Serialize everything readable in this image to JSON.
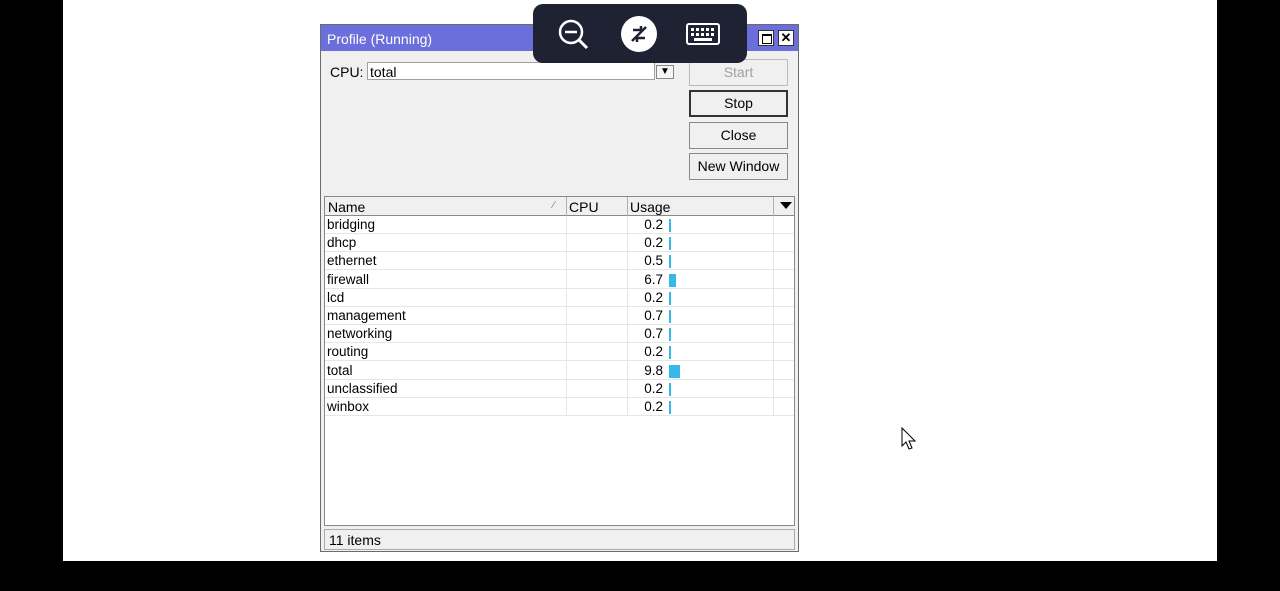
{
  "window": {
    "title": "Profile (Running)"
  },
  "cpu": {
    "label": "CPU:",
    "value": "total"
  },
  "buttons": {
    "start": "Start",
    "stop": "Stop",
    "close": "Close",
    "new_window": "New Window"
  },
  "table": {
    "columns": [
      "Name",
      "CPU",
      "Usage"
    ],
    "rows": [
      {
        "name": "bridging",
        "usage": "0.2"
      },
      {
        "name": "dhcp",
        "usage": "0.2"
      },
      {
        "name": "ethernet",
        "usage": "0.5"
      },
      {
        "name": "firewall",
        "usage": "6.7"
      },
      {
        "name": "lcd",
        "usage": "0.2"
      },
      {
        "name": "management",
        "usage": "0.7"
      },
      {
        "name": "networking",
        "usage": "0.7"
      },
      {
        "name": "routing",
        "usage": "0.2"
      },
      {
        "name": "total",
        "usage": "9.8"
      },
      {
        "name": "unclassified",
        "usage": "0.2"
      },
      {
        "name": "winbox",
        "usage": "0.2"
      }
    ]
  },
  "status": {
    "count": "11 items"
  },
  "toolbar_icons": [
    "zoom-out-icon",
    "remote-desktop-icon",
    "keyboard-icon"
  ],
  "colors": {
    "titlebar": "#6b6fdc",
    "usage_bar": "#36b8ea",
    "overlay": "#1e2233"
  }
}
